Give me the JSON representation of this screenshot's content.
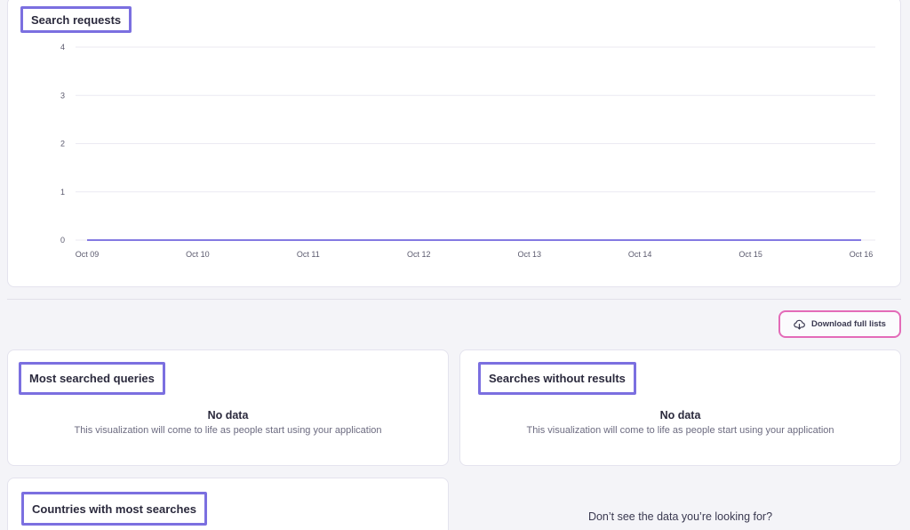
{
  "search_requests": {
    "title": "Search requests",
    "chart_data": {
      "type": "line",
      "title": "Search requests",
      "xlabel": "",
      "ylabel": "",
      "x": [
        "Oct 09",
        "Oct 10",
        "Oct 11",
        "Oct 12",
        "Oct 13",
        "Oct 14",
        "Oct 15",
        "Oct 16"
      ],
      "series": [
        {
          "values": [
            0,
            0,
            0,
            0,
            0,
            0,
            0,
            0
          ],
          "color": "#5b4fd8"
        }
      ],
      "yticks": [
        0,
        1,
        2,
        3,
        4
      ],
      "ylim": [
        0,
        4
      ],
      "grid": true
    }
  },
  "download_button": {
    "label": "Download full lists",
    "icon": "cloud-download-icon"
  },
  "most_searched_queries": {
    "title": "Most searched queries",
    "empty_title": "No data",
    "empty_message": "This visualization will come to life as people start using your application"
  },
  "searches_without_results": {
    "title": "Searches without results",
    "empty_title": "No data",
    "empty_message": "This visualization will come to life as people start using your application"
  },
  "countries": {
    "title": "Countries with most searches"
  },
  "help": {
    "prompt": "Don’t see the data you’re looking for?"
  },
  "colors": {
    "highlight": "#7b6fe0",
    "button_border": "#e36bb8",
    "line": "#5b4fd8",
    "grid": "#ebeaf2"
  }
}
